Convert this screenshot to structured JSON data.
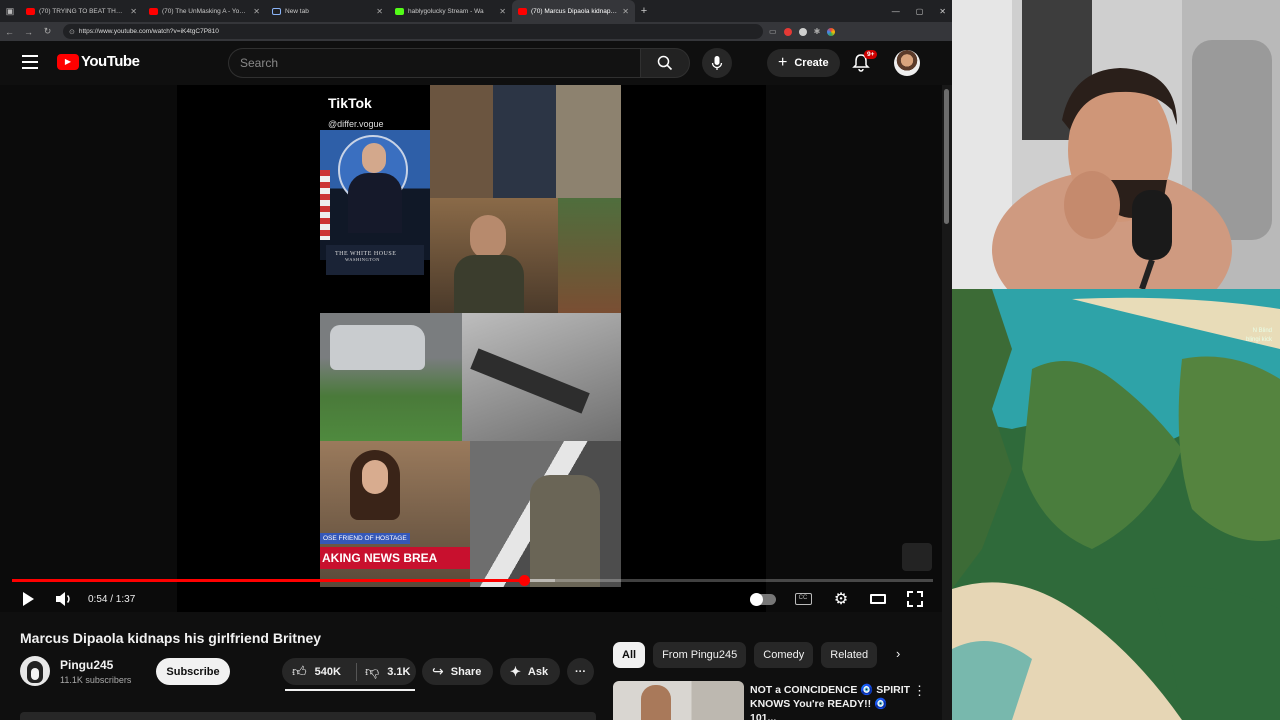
{
  "browser": {
    "tabs": [
      {
        "title": "(70) TRYING TO BEAT THE SLICE",
        "favicon_color": "#ff0000",
        "active": false
      },
      {
        "title": "(70) The UnMasking A - YouTube",
        "favicon_color": "#ff0000",
        "active": false
      },
      {
        "title": "New tab",
        "favicon_color": "#8ab4f8",
        "active": false
      },
      {
        "title": "hablygolucky Stream - Wa",
        "favicon_color": "#53fc18",
        "active": false
      },
      {
        "title": "(70) Marcus Dipaola kidnaps his",
        "favicon_color": "#ff0000",
        "active": true
      }
    ],
    "url": "https://www.youtube.com/watch?v=iK4tgC7P810"
  },
  "youtube": {
    "logo_text": "YouTube",
    "search_placeholder": "Search",
    "create_label": "Create",
    "notification_badge": "9+"
  },
  "video_frame": {
    "tiktok_label": "TikTok",
    "tiktok_handle": "@differ.vogue",
    "podium_text": "THE WHITE HOUSE",
    "podium_subtext": "WASHINGTON",
    "lower_third_small": "OSE FRIEND OF HOSTAGE",
    "lower_third_big": "AKING NEWS  BREA"
  },
  "player": {
    "time_current": "0:54",
    "time_total": "1:37",
    "time_display": "0:54 / 1:37",
    "progress": 0.556,
    "buffered": 0.59
  },
  "video": {
    "title": "Marcus Dipaola kidnaps his girlfriend Britney",
    "channel": "Pingu245",
    "subscribers": "11.1K subscribers",
    "subscribe_label": "Subscribe",
    "likes": "540K",
    "dislikes": "3.1K",
    "share_label": "Share",
    "ask_label": "Ask"
  },
  "chips": [
    {
      "label": "All",
      "selected": true
    },
    {
      "label": "From Pingu245",
      "selected": false
    },
    {
      "label": "Comedy",
      "selected": false
    },
    {
      "label": "Related",
      "selected": false
    }
  ],
  "recommendation": {
    "title": "NOT a COINCIDENCE 🧿 SPIRIT KNOWS You're READY!! 🧿 101..."
  },
  "overlay": {
    "tag_line1": "N Blind",
    "tag_line2": "blingi kick"
  },
  "colors": {
    "accent_red": "#ff0000",
    "background": "#0f0f0f",
    "chip_bg": "#272727"
  }
}
